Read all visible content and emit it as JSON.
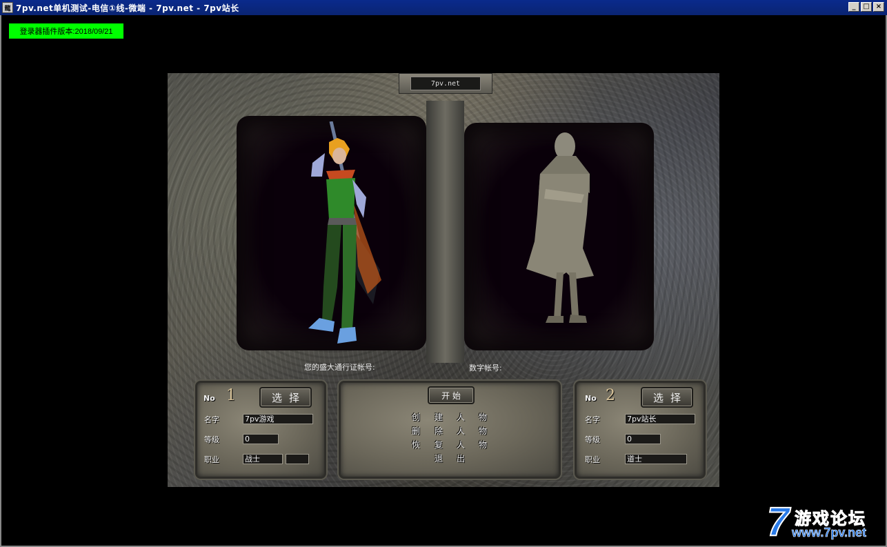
{
  "window": {
    "title": "7pv.net单机测试-电信①线-微端 - 7pv.net - 7pv站长",
    "icon": "game-app-icon",
    "icon_glyph": "龍",
    "controls": {
      "minimize": "_",
      "maximize": "□",
      "close": "×"
    }
  },
  "version_badge": "登录器插件版本:2018/09/21",
  "game": {
    "server_name": "7pv.net",
    "account_label": "您的盛大通行证帐号:",
    "digital_account_label": "数字帐号:",
    "slots": [
      {
        "no_label": "No",
        "no_number": "1",
        "select_label": "选择",
        "name_label": "名字",
        "name_value": "7pv游戏",
        "level_label": "等级",
        "level_value": "0",
        "job_label": "职业",
        "job_value": "战士"
      },
      {
        "no_label": "No",
        "no_number": "2",
        "select_label": "选择",
        "name_label": "名字",
        "name_value": "7pv站长",
        "level_label": "等级",
        "level_value": "0",
        "job_label": "职业",
        "job_value": "道士"
      }
    ],
    "menu": {
      "start": "开 始",
      "create": [
        "创",
        "建",
        "人",
        "物"
      ],
      "delete": [
        "删",
        "除",
        "人",
        "物"
      ],
      "restore": [
        "恢",
        "复",
        "人",
        "物"
      ],
      "exit": [
        "退",
        "出"
      ]
    }
  },
  "watermark": {
    "seven": "7",
    "title": "游戏论坛",
    "url": "www.7pv.net"
  },
  "colors": {
    "titlebar": "#0a2472",
    "version_badge": "#00ff00",
    "logo": "#2a7be8"
  }
}
